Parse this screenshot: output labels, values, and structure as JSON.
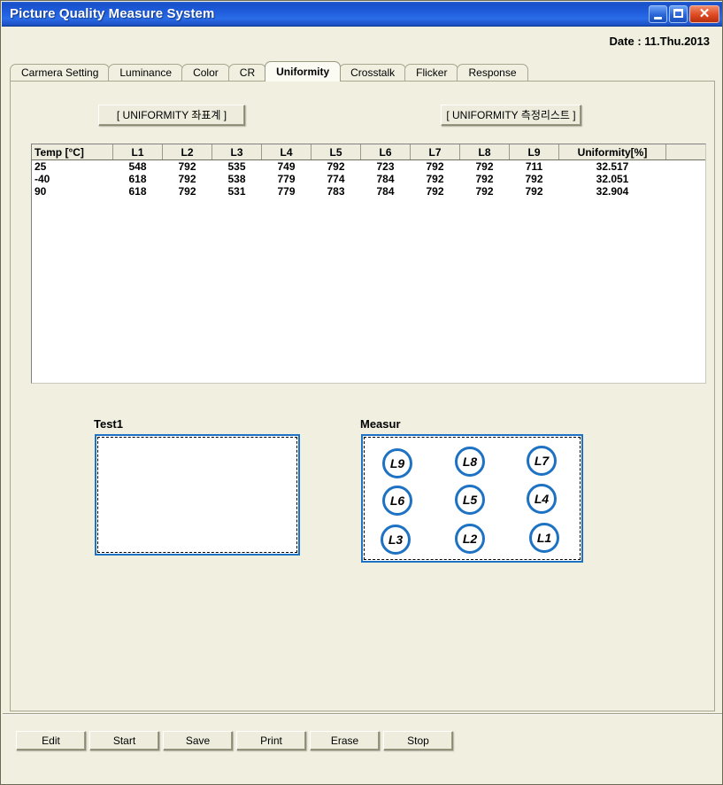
{
  "window": {
    "title": "Picture Quality Measure System",
    "controls": [
      {
        "name": "minimize",
        "glyph": ""
      },
      {
        "name": "maximize",
        "glyph": ""
      },
      {
        "name": "close",
        "glyph": "✕"
      }
    ]
  },
  "header": {
    "date": "Date : 11.Thu.2013"
  },
  "tabs": [
    {
      "label": "Carmera Setting",
      "active": false
    },
    {
      "label": "Luminance",
      "active": false
    },
    {
      "label": "Color",
      "active": false
    },
    {
      "label": "CR",
      "active": false
    },
    {
      "label": "Uniformity",
      "active": true
    },
    {
      "label": "Crosstalk",
      "active": false
    },
    {
      "label": "Flicker",
      "active": false
    },
    {
      "label": "Response",
      "active": false
    }
  ],
  "toolbar": {
    "coord_label": "[ UNIFORMITY 좌표계 ]",
    "list_label": "[ UNIFORMITY 측정리스트 ]"
  },
  "grid": {
    "columns": [
      "Temp [°C]",
      "L1",
      "L2",
      "L3",
      "L4",
      "L5",
      "L6",
      "L7",
      "L8",
      "L9",
      "Uniformity[%]",
      ""
    ],
    "rows": [
      [
        "25",
        "548",
        "792",
        "535",
        "749",
        "792",
        "723",
        "792",
        "792",
        "711",
        "32.517",
        ""
      ],
      [
        "-40",
        "618",
        "792",
        "538",
        "779",
        "774",
        "784",
        "792",
        "792",
        "792",
        "32.051",
        ""
      ],
      [
        "90",
        "618",
        "792",
        "531",
        "779",
        "783",
        "784",
        "792",
        "792",
        "792",
        "32.904",
        ""
      ]
    ]
  },
  "preview": {
    "test_label": "Test1",
    "measur_label": "Measur",
    "nodes": [
      "L9",
      "L8",
      "L7",
      "L6",
      "L5",
      "L4",
      "L3",
      "L2",
      "L1"
    ]
  },
  "footer": {
    "buttons": [
      "Edit",
      "Start",
      "Save",
      "Print",
      "Erase",
      "Stop"
    ]
  },
  "colors": {
    "title_bar": "#1f5ddd",
    "window_bg": "#F0EFE0",
    "accent_blue": "#1E72C4",
    "close_red": "#de4a22"
  }
}
